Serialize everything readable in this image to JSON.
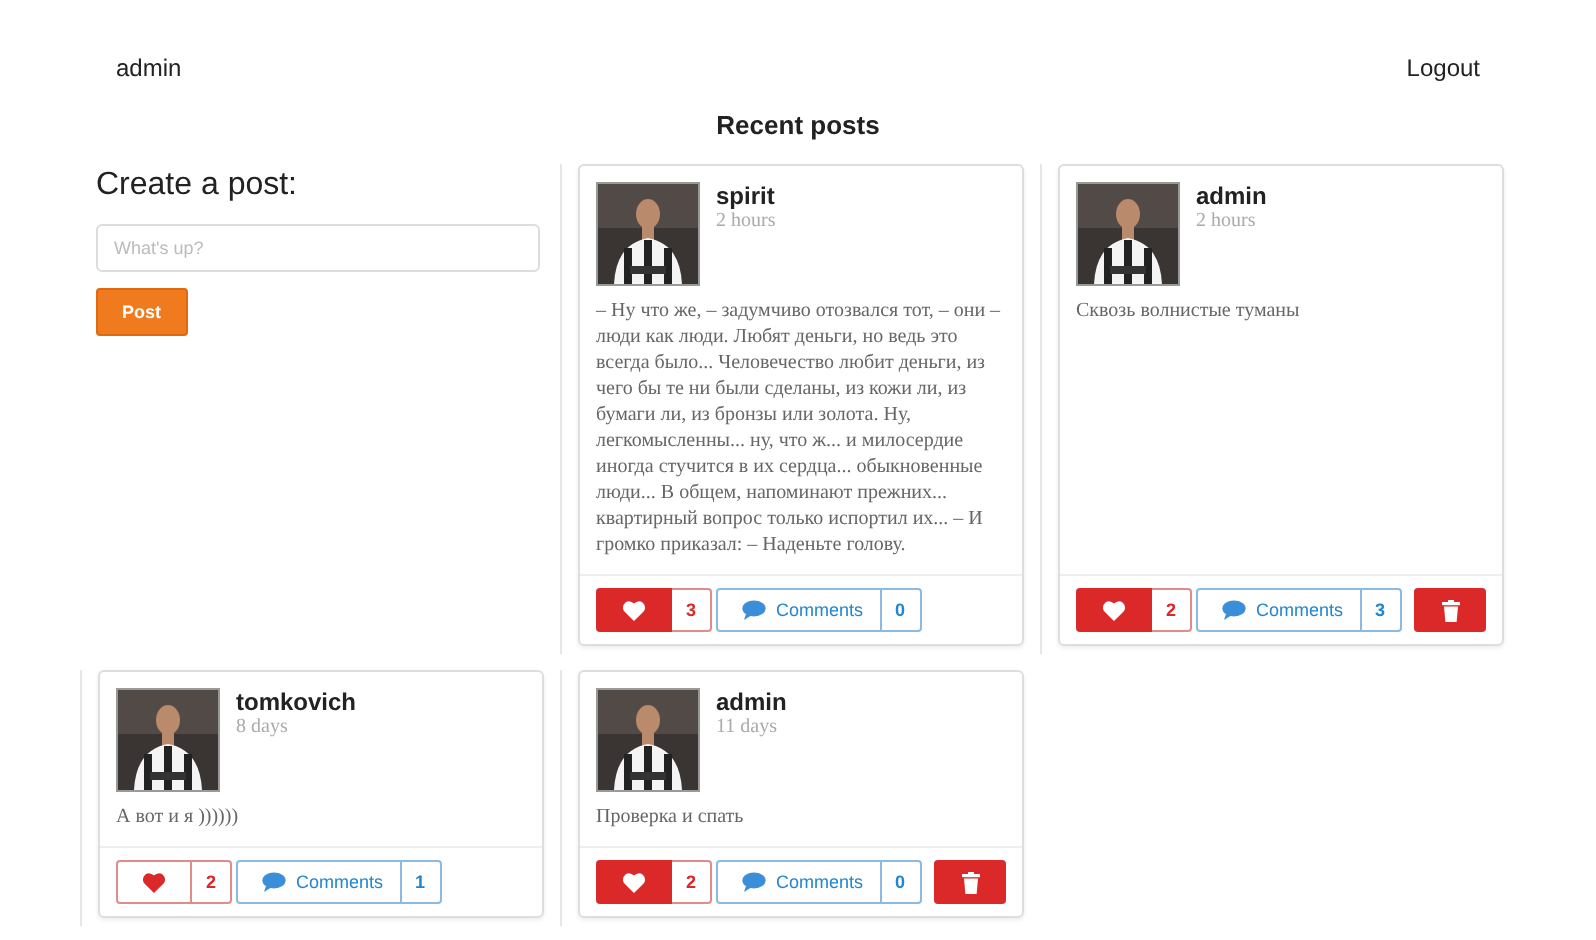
{
  "nav": {
    "user": "admin",
    "logout": "Logout"
  },
  "heading": "Recent posts",
  "composer": {
    "title": "Create a post:",
    "placeholder": "What's up?",
    "button": "Post"
  },
  "posts": [
    {
      "author": "spirit",
      "time": "2 hours",
      "text": "– Ну что же, – задумчиво отозвался тот, – они – люди как люди. Любят деньги, но ведь это всегда было... Человечество любит деньги, из чего бы те ни были сделаны, из кожи ли, из бумаги ли, из бронзы или золота. Ну, легкомысленны... ну, что ж... и милосердие иногда стучится в их сердца... обыкновенные люди... В общем, напоминают прежних... квартирный вопрос только испортил их... – И громко приказал: – Наденьте голову.",
      "liked": true,
      "likes": "3",
      "comments_label": "Comments",
      "comments": "0",
      "deletable": false
    },
    {
      "author": "admin",
      "time": "2 hours",
      "text": "Сквозь волнистые туманы",
      "liked": true,
      "likes": "2",
      "comments_label": "Comments",
      "comments": "3",
      "deletable": true
    },
    {
      "author": "tomkovich",
      "time": "8 days",
      "text": "А вот и я ))))))",
      "liked": false,
      "likes": "2",
      "comments_label": "Comments",
      "comments": "1",
      "deletable": false
    },
    {
      "author": "admin",
      "time": "11 days",
      "text": "Проверка и спать",
      "liked": true,
      "likes": "2",
      "comments_label": "Comments",
      "comments": "0",
      "deletable": true
    }
  ]
}
